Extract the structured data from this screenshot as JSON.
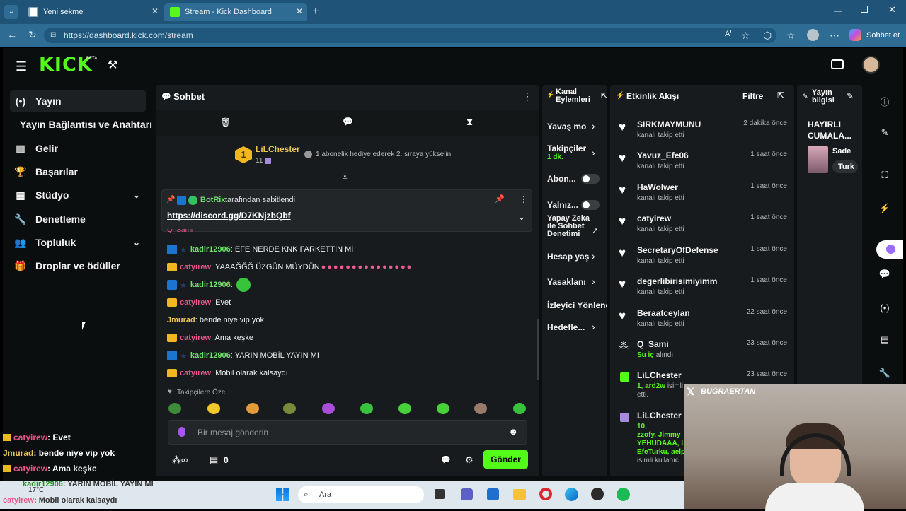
{
  "browser": {
    "tabs": [
      {
        "title": "Yeni sekme"
      },
      {
        "title": "Stream - Kick Dashboard"
      }
    ],
    "url": "https://dashboard.kick.com/stream",
    "copilot_label": "Sohbet et"
  },
  "kick": {
    "logo": "KICK",
    "beta": "BETA",
    "sidebar": [
      {
        "label": "Yayın",
        "icon": "broadcast-icon"
      },
      {
        "label": "Yayın Bağlantısı ve Anahtarı",
        "icon": ""
      },
      {
        "label": "Gelir",
        "icon": "chart-icon"
      },
      {
        "label": "Başarılar",
        "icon": "trophy-icon"
      },
      {
        "label": "Stüdyo",
        "icon": "studio-icon"
      },
      {
        "label": "Denetleme",
        "icon": "wrench-icon"
      },
      {
        "label": "Topluluk",
        "icon": "people-icon"
      },
      {
        "label": "Droplar ve ödüller",
        "icon": "gift-icon"
      }
    ],
    "chat": {
      "title": "Sohbet",
      "sub_gift": {
        "user": "LiLChester",
        "level": "11",
        "message": "1 abonelik hediye ederek 2. sıraya yükselin",
        "rank": "1"
      },
      "pinned": {
        "user": "BotRix",
        "suffix": "tarafından sabitlendi",
        "link": "https://discord.gg/D7KNjzbQbf",
        "hidden_user": "Q_Sami"
      },
      "messages": [
        {
          "user": "kadir12906",
          "text": ": EFE NERDE KNK FARKETTİN Mİ",
          "style": "green"
        },
        {
          "user": "catyirew",
          "text": ": YAAAĞĞĞ ÜZGÜN MÜYDÜN",
          "style": "pink"
        },
        {
          "user": "kadir12906",
          "text": ":",
          "style": "green"
        },
        {
          "user": "catyirew",
          "text": ": Evet",
          "style": "pink"
        },
        {
          "user": "Jmurad",
          "text": ": bende niye vip yok",
          "style": "yellow"
        },
        {
          "user": "catyirew",
          "text": ": Ama keşke",
          "style": "pink"
        },
        {
          "user": "kadir12906",
          "text": ": YARIN MOBİL YAYIN MI",
          "style": "green"
        },
        {
          "user": "catyirew",
          "text": ": Mobil olarak kalsaydı",
          "style": "pink"
        }
      ],
      "followers_only": "Takipçilere Özel",
      "placeholder": "Bir mesaj gönderin",
      "points": "0",
      "send": "Gönder"
    },
    "actions": {
      "title": "Kanal Eylemleri",
      "items": [
        {
          "label": "Yavaş mo"
        },
        {
          "label": "Takipçiler",
          "sub": "1 dk."
        },
        {
          "label": "Abon..."
        },
        {
          "label": "Yalnız..."
        },
        {
          "label": "Yapay Zeka ile Sohbet Denetimi"
        },
        {
          "label": "Hesap yaş"
        },
        {
          "label": "Yasaklanı"
        },
        {
          "label": "İzleyici Yönlend"
        },
        {
          "label": "Hedefle..."
        }
      ]
    },
    "activity": {
      "title": "Etkinlik Akışı",
      "filter": "Filtre",
      "events": [
        {
          "name": "SIRKMAYMUNU",
          "sub": "kanalı takip etti",
          "time": "2 dakika önce"
        },
        {
          "name": "Yavuz_Efe06",
          "sub": "kanalı takip etti",
          "time": "1 saat önce"
        },
        {
          "name": "HaWolwer",
          "sub": "kanalı takip etti",
          "time": "1 saat önce"
        },
        {
          "name": "catyirew",
          "sub": "kanalı takip etti",
          "time": "1 saat önce"
        },
        {
          "name": "SecretaryOfDefense",
          "sub": "kanalı takip etti",
          "time": "1 saat önce"
        },
        {
          "name": "degerlibirisimiyimm",
          "sub": "kanalı takip etti",
          "time": "1 saat önce"
        },
        {
          "name": "Beraatceylan",
          "sub": "kanalı takip etti",
          "time": "22 saat önce"
        }
      ],
      "qsami": {
        "name": "Q_Sami",
        "sub_green": "Su iç",
        "sub_rest": "alındı",
        "time": "23 saat önce"
      },
      "lil1": {
        "name": "LiLChester",
        "sub_green": "1, ard2w",
        "sub_rest": "isimli...",
        "sub2": "etti.",
        "time": "23 saat önce"
      },
      "lil2": {
        "name": "LiLChester",
        "lines": [
          "10,",
          "zzofy, Jimmy",
          "YEHUDAAA, L",
          "EfeTurku, aelp"
        ],
        "sub_rest": "isimli kullanıc"
      }
    },
    "stream_info": {
      "title": "Yayın bilgisi",
      "heading": "HAYIRLI CUMALA...",
      "category_short": "Sade",
      "tag": "Turk"
    }
  },
  "overlay": {
    "lines": [
      {
        "user": "catyirew",
        "text": ": Evet"
      },
      {
        "user": "Jmurad",
        "text": ": bende niye vip yok"
      },
      {
        "user": "catyirew",
        "text": ": Ama keşke"
      },
      {
        "user": "kadir12906",
        "text": ": YARIN MOBİL YAYIN MI"
      },
      {
        "user": "catyirew",
        "text": ": Mobil olarak kalsaydı"
      }
    ],
    "weather": "17°C",
    "cam_name": "BUĞRAERTAN"
  },
  "taskbar": {
    "search": "Ara"
  }
}
